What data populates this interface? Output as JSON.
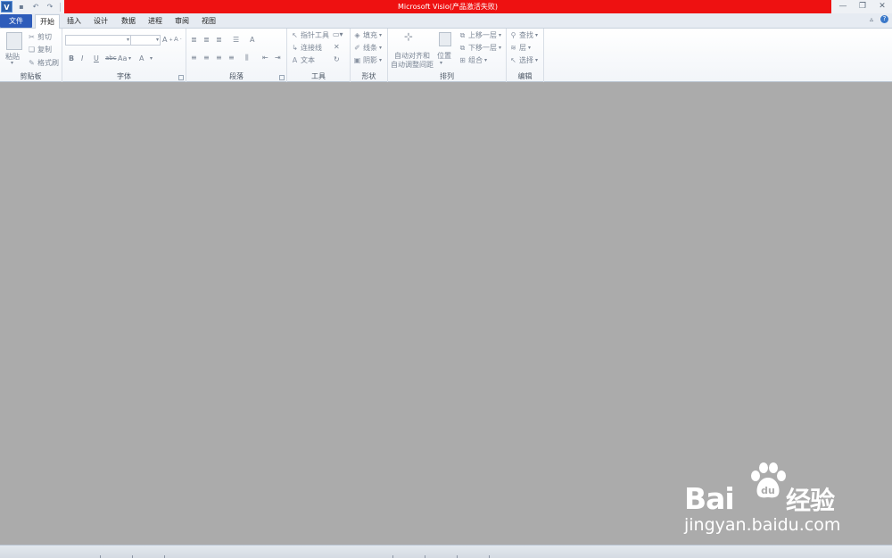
{
  "window": {
    "title": "Microsoft Visio(产品激活失败)",
    "app_icon": "V"
  },
  "tabs": [
    {
      "label": "文件"
    },
    {
      "label": "开始"
    },
    {
      "label": "插入"
    },
    {
      "label": "设计"
    },
    {
      "label": "数据"
    },
    {
      "label": "进程"
    },
    {
      "label": "审阅"
    },
    {
      "label": "视图"
    }
  ],
  "ribbon": {
    "clipboard": {
      "label": "剪贴板",
      "paste": "粘贴",
      "cut": "剪切",
      "copy": "复制",
      "format_painter": "格式刷"
    },
    "font": {
      "label": "字体",
      "bold": "B",
      "italic": "I",
      "underline": "U",
      "strike": "abc",
      "case": "Aa",
      "font_color": "A"
    },
    "paragraph": {
      "label": "段落"
    },
    "tools": {
      "label": "工具",
      "pointer": "指针工具",
      "connector": "连接线",
      "text": "文本"
    },
    "shape": {
      "label": "形状",
      "fill": "填充",
      "line": "线条",
      "shadow": "阴影"
    },
    "arrange": {
      "label": "排列",
      "auto_align_1": "自动对齐和",
      "auto_align_2": "自动调整间距",
      "position": "位置",
      "bring_forward": "上移一层",
      "send_backward": "下移一层",
      "group": "组合"
    },
    "editing": {
      "label": "编辑",
      "find": "查找",
      "layers": "层",
      "select": "选择"
    }
  },
  "watermark": {
    "logo_left": "Bai",
    "logo_right": "经验",
    "url": "jingyan.baidu.com"
  },
  "colors": {
    "title_bar": "#ee1111",
    "file_tab": "#2e5cba",
    "canvas": "#ababab"
  }
}
